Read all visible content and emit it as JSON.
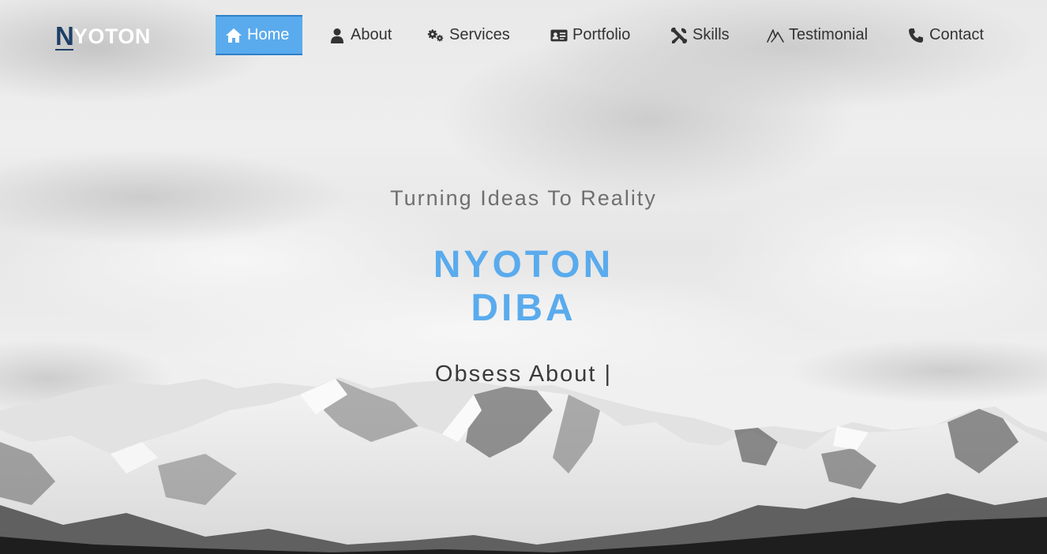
{
  "logo": {
    "first_letter": "N",
    "rest": "YOTON"
  },
  "nav": [
    {
      "label": "Home",
      "icon": "home-icon",
      "active": true
    },
    {
      "label": "About",
      "icon": "user-icon",
      "active": false
    },
    {
      "label": "Services",
      "icon": "gears-icon",
      "active": false
    },
    {
      "label": "Portfolio",
      "icon": "id-card-icon",
      "active": false
    },
    {
      "label": "Skills",
      "icon": "tools-icon",
      "active": false
    },
    {
      "label": "Testimonial",
      "icon": "signature-icon",
      "active": false
    },
    {
      "label": "Contact",
      "icon": "phone-icon",
      "active": false
    }
  ],
  "hero": {
    "tagline": "Turning Ideas To Reality",
    "name_first": "NYOTON",
    "name_last": "DIBA",
    "typed_text": "Obsess About |"
  },
  "colors": {
    "accent": "#5aabed",
    "logo_dark": "#1e3f66",
    "nav_text": "#333333",
    "background": "#ececec"
  }
}
